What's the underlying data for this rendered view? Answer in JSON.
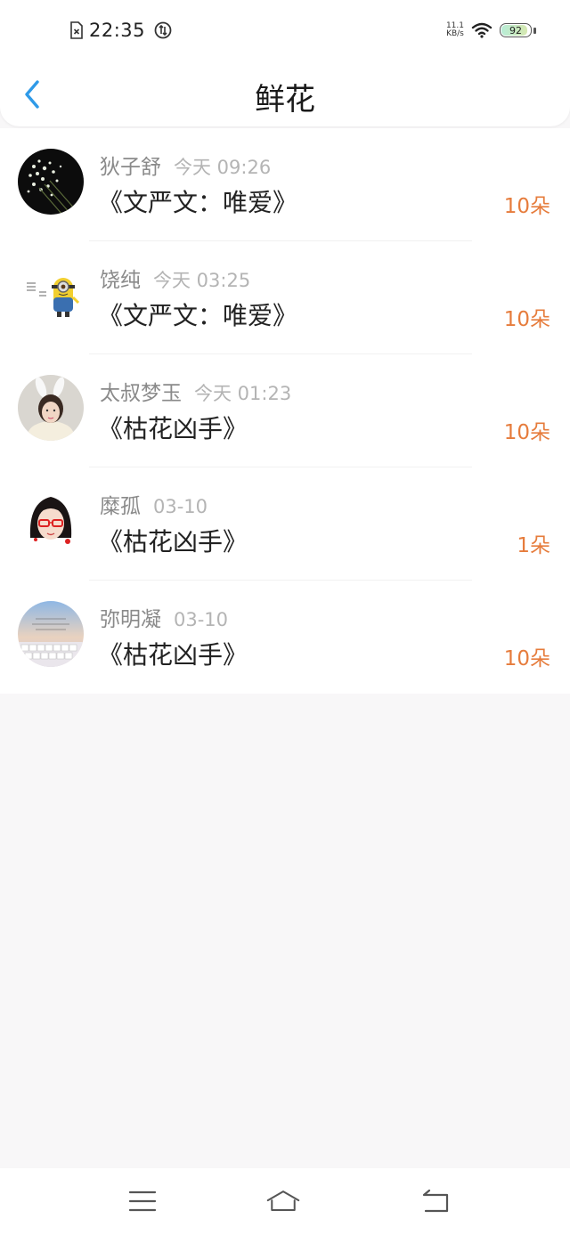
{
  "status_bar": {
    "time": "22:35",
    "net_speed_value": "11.1",
    "net_speed_unit": "KB/s",
    "battery": "92",
    "battery_level": 0.92
  },
  "header": {
    "title": "鲜花"
  },
  "records": [
    {
      "name": "狄子舒",
      "time": "今天 09:26",
      "work": "《文严文：唯爱》",
      "count": "10朵",
      "avatar": "flowers-photo"
    },
    {
      "name": "饶纯",
      "time": "今天 03:25",
      "work": "《文严文：唯爱》",
      "count": "10朵",
      "avatar": "minion-image"
    },
    {
      "name": "太叔梦玉",
      "time": "今天 01:23",
      "work": "《枯花凶手》",
      "count": "10朵",
      "avatar": "girl-bunny-ears-photo"
    },
    {
      "name": "糜孤",
      "time": "03-10",
      "work": "《枯花凶手》",
      "count": "1朵",
      "avatar": "cartoon-girl-glasses"
    },
    {
      "name": "弥明凝",
      "time": "03-10",
      "work": "《枯花凶手》",
      "count": "10朵",
      "avatar": "keyboard-sky-image"
    }
  ],
  "colors": {
    "accent": "#2f9ae8",
    "count": "#e67c3c",
    "background": "#f8f7f8"
  },
  "nav": {
    "menu_icon": "menu-icon",
    "home_icon": "home-icon",
    "back_icon": "return-icon"
  }
}
